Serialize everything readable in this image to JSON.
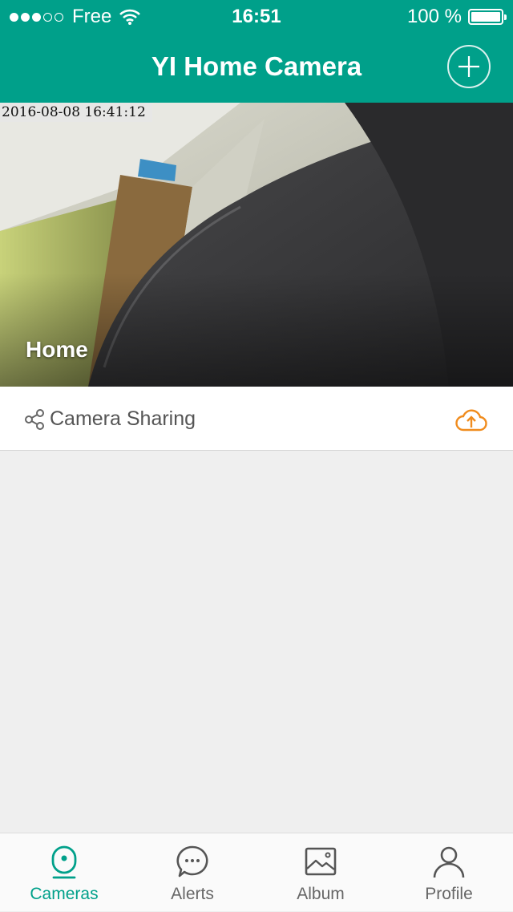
{
  "status_bar": {
    "carrier": "Free",
    "time": "16:51",
    "battery": "100 %",
    "signal_bars_filled": 3,
    "signal_bars_total": 5
  },
  "nav": {
    "title": "YI Home Camera",
    "add_icon": "plus-circle-icon"
  },
  "camera": {
    "timestamp": "2016-08-08 16:41:12",
    "name": "Home"
  },
  "sharing": {
    "label": "Camera Sharing",
    "share_icon": "share-icon",
    "upload_icon": "cloud-upload-icon",
    "upload_color": "#f08c1e"
  },
  "tabs": [
    {
      "label": "Cameras",
      "icon": "camera-icon",
      "active": true
    },
    {
      "label": "Alerts",
      "icon": "chat-bubble-icon",
      "active": false
    },
    {
      "label": "Album",
      "icon": "image-icon",
      "active": false
    },
    {
      "label": "Profile",
      "icon": "person-icon",
      "active": false
    }
  ],
  "colors": {
    "accent": "#00a08a",
    "background": "#efefef",
    "inactive_tab": "#666666"
  }
}
